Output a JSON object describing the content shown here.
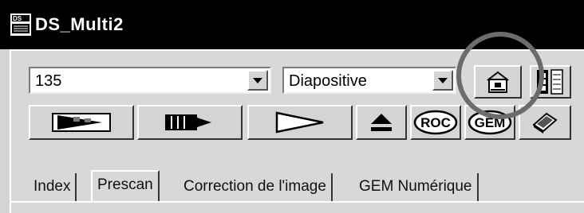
{
  "window": {
    "title": "DS_Multi2",
    "icon": "app-scanner-icon"
  },
  "toolbar": {
    "film_format": "135",
    "film_type": "Diapositive",
    "buttons": [
      {
        "icon": "preferences-icon"
      },
      {
        "icon": "film-strip-icon"
      },
      {
        "icon": "prescan-icon"
      },
      {
        "icon": "autofocus-icon"
      },
      {
        "icon": "scan-icon"
      },
      {
        "icon": "eject-icon"
      },
      {
        "icon": "roc-icon",
        "label": "ROC"
      },
      {
        "icon": "gem-icon",
        "label": "GEM"
      },
      {
        "icon": "help-book-icon"
      }
    ]
  },
  "tabs": [
    {
      "label": "Index"
    },
    {
      "label": "Prescan"
    },
    {
      "label": "Correction de l'image"
    },
    {
      "label": "GEM Numérique"
    }
  ],
  "highlight": {
    "target": "preferences-button",
    "color": "#6c6c6c"
  }
}
